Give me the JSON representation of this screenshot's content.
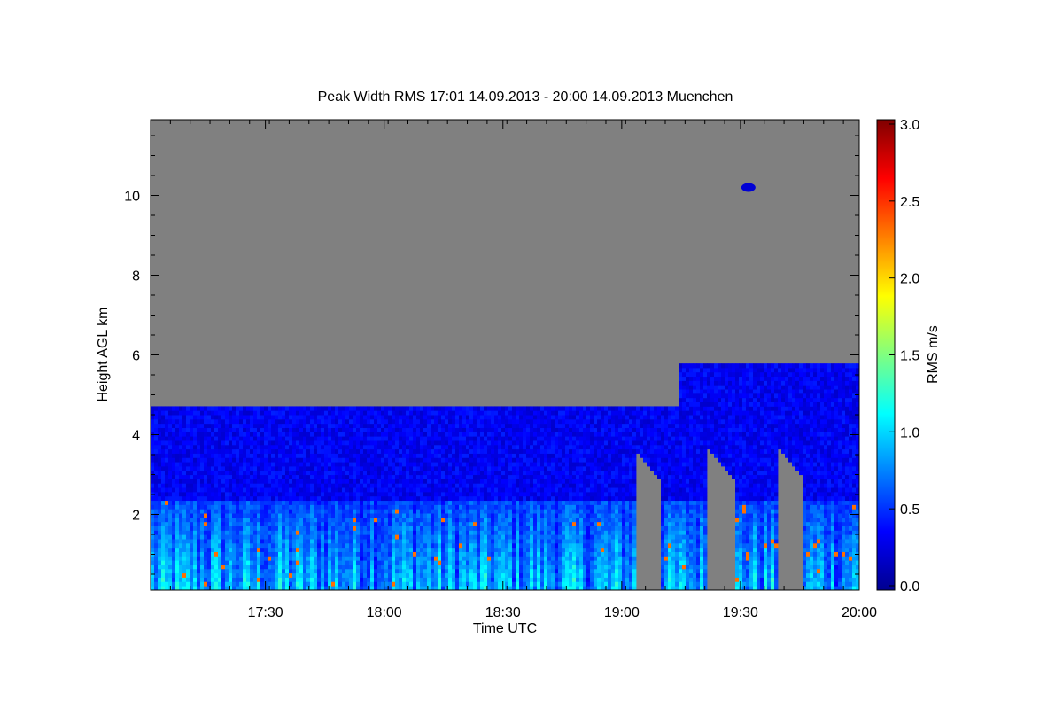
{
  "chart_data": {
    "type": "heatmap",
    "title": "Peak Width RMS   17:01 14.09.2013 - 20:00 14.09.2013 Muenchen",
    "xlabel": "Time UTC",
    "ylabel": "Height AGL km",
    "colorbar_label": "RMS m/s",
    "x_ticks": [
      "17:30",
      "18:00",
      "18:30",
      "19:00",
      "19:30",
      "20:00"
    ],
    "x_tick_minutes": [
      29,
      59,
      89,
      119,
      149,
      179
    ],
    "xlim_minutes": [
      0,
      179
    ],
    "y_ticks": [
      2,
      4,
      6,
      8,
      10
    ],
    "ylim": [
      0.1,
      11.9
    ],
    "colorbar_ticks": [
      "0.0",
      "0.5",
      "1.0",
      "1.5",
      "2.0",
      "2.5",
      "3.0"
    ],
    "colorbar_range": [
      0,
      3
    ],
    "colormap": "jet",
    "missing_color": "#808080",
    "grid": false,
    "legend": "colorbar-right",
    "regions": {
      "boundary_layer_top_km": 2.3,
      "cloud_top_km_early": 4.65,
      "cloud_top_km_late": 5.7,
      "cloud_top_rise_minute": 133,
      "isolated_patch": {
        "minute": 151,
        "height_km": 10.2
      },
      "gap_columns_minutes": [
        [
          122,
          128
        ],
        [
          140,
          147
        ],
        [
          158,
          164
        ]
      ]
    }
  }
}
